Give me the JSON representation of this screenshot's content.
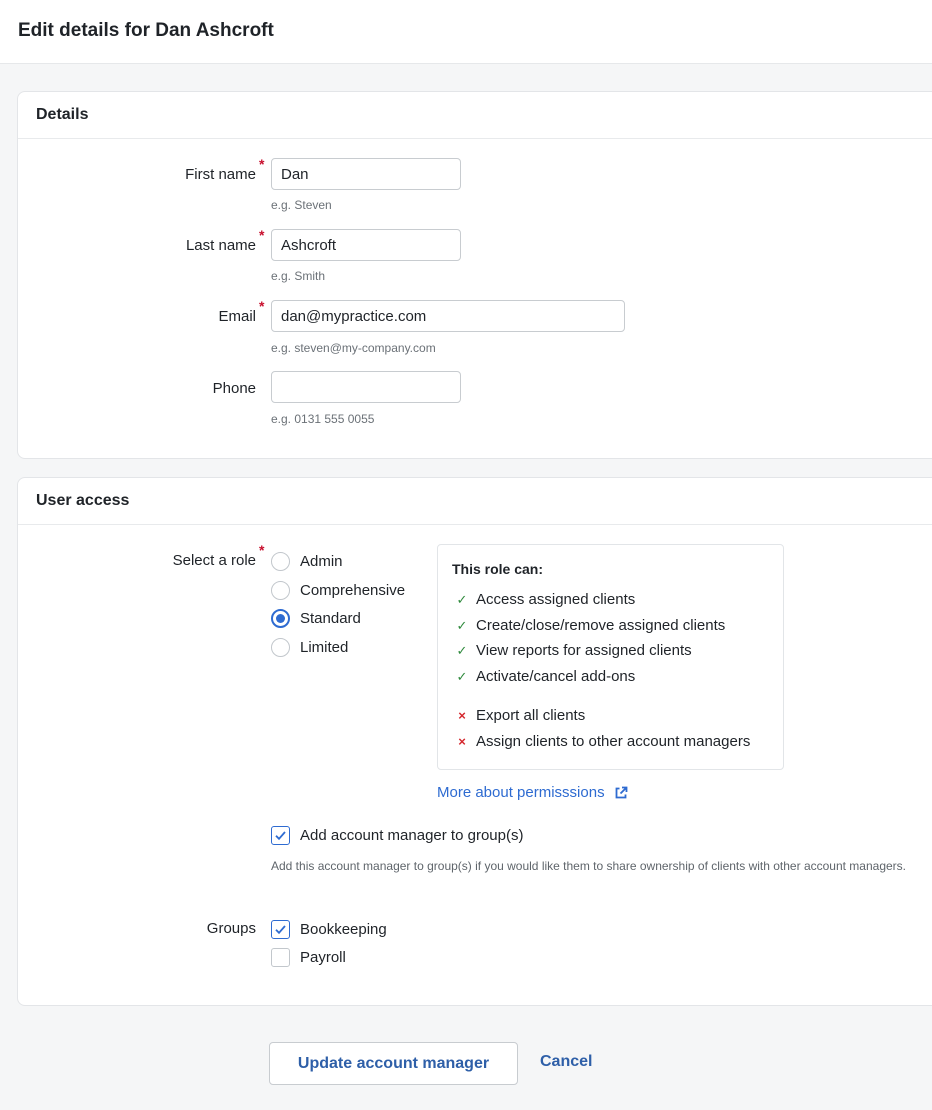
{
  "page": {
    "title": "Edit details for Dan Ashcroft"
  },
  "details": {
    "heading": "Details",
    "first_name": {
      "label": "First name",
      "value": "Dan",
      "hint": "e.g. Steven"
    },
    "last_name": {
      "label": "Last name",
      "value": "Ashcroft",
      "hint": "e.g. Smith"
    },
    "email": {
      "label": "Email",
      "value": "dan@mypractice.com",
      "hint": "e.g. steven@my-company.com"
    },
    "phone": {
      "label": "Phone",
      "value": "",
      "hint": "e.g. 0131 555 0055"
    },
    "required_marker": "*"
  },
  "access": {
    "heading": "User access",
    "role_label": "Select a role",
    "roles": [
      {
        "label": "Admin",
        "selected": false
      },
      {
        "label": "Comprehensive",
        "selected": false
      },
      {
        "label": "Standard",
        "selected": true
      },
      {
        "label": "Limited",
        "selected": false
      }
    ],
    "permissions": {
      "title": "This role can:",
      "allowed": [
        "Access assigned clients",
        "Create/close/remove assigned clients",
        "View reports for assigned clients",
        "Activate/cancel add-ons"
      ],
      "denied": [
        "Export all clients",
        "Assign clients to other account managers"
      ],
      "allowed_mark": "✓",
      "denied_mark": "×"
    },
    "more_link": "More about permisssions",
    "add_to_group": {
      "label": "Add account manager to group(s)",
      "checked": true
    },
    "description": "Add this account manager to group(s) if you would like them to share ownership of clients with other account managers.",
    "groups_label": "Groups",
    "groups": [
      {
        "label": "Bookkeeping",
        "checked": true
      },
      {
        "label": "Payroll",
        "checked": false
      }
    ]
  },
  "actions": {
    "update": "Update account manager",
    "cancel": "Cancel"
  },
  "colors": {
    "accent": "#2e6bd1",
    "link": "#2e5fa8",
    "required": "#c8102e",
    "allowed": "#2f8a3d",
    "denied": "#d4262c"
  }
}
